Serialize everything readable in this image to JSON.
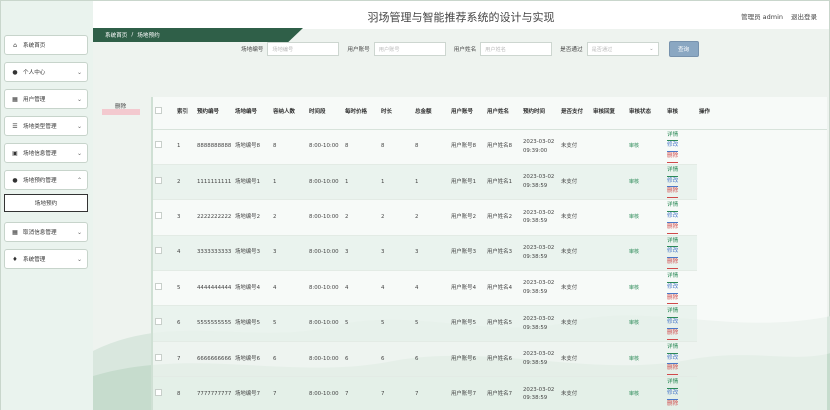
{
  "header": {
    "title": "羽场管理与智能推荐系统的设计与实现",
    "user_label": "管理员 admin",
    "logout": "退出登录"
  },
  "sidebar": {
    "items": [
      {
        "label": "系统首页",
        "icon": "home-icon"
      },
      {
        "label": "个人中心",
        "icon": "person-icon"
      },
      {
        "label": "用户管理",
        "icon": "grid-icon"
      },
      {
        "label": "场地类型管理",
        "icon": "list-icon"
      },
      {
        "label": "场地信息管理",
        "icon": "briefcase-icon"
      },
      {
        "label": "场地预约管理",
        "icon": "person-icon"
      },
      {
        "label": "取消信息管理",
        "icon": "grid-icon"
      },
      {
        "label": "系统管理",
        "icon": "pin-icon"
      }
    ],
    "sub_item": "场地预约"
  },
  "breadcrumb": {
    "home": "系统首页",
    "sep": "/",
    "current": "场地预约"
  },
  "search": {
    "field1_label": "场地编号",
    "field1_placeholder": "场地编号",
    "field2_label": "用户账号",
    "field2_placeholder": "用户账号",
    "field3_label": "用户姓名",
    "field3_placeholder": "用户姓名",
    "field4_label": "是否通过",
    "field4_placeholder": "是否通过",
    "button": "查询"
  },
  "delete_label": "删除",
  "table": {
    "headers": [
      "索引",
      "预约编号",
      "场地编号",
      "容纳人数",
      "时间段",
      "每时价格",
      "时长",
      "总金额",
      "用户账号",
      "用户姓名",
      "预约时间",
      "是否支付",
      "审核回复",
      "审核状态",
      "审核",
      "操作"
    ],
    "rows": [
      [
        "1",
        "8888888888",
        "场地编号8",
        "8",
        "8:00-10:00",
        "8",
        "8",
        "8",
        "用户账号8",
        "用户姓名8",
        "2023-03-02 09:39:00",
        "未支付",
        "",
        "通过",
        "审核"
      ],
      [
        "2",
        "1111111111",
        "场地编号1",
        "1",
        "8:00-10:00",
        "1",
        "1",
        "1",
        "用户账号1",
        "用户姓名1",
        "2023-03-02 09:38:59",
        "未支付",
        "",
        "通过",
        "审核"
      ],
      [
        "3",
        "2222222222",
        "场地编号2",
        "2",
        "8:00-10:00",
        "2",
        "2",
        "2",
        "用户账号2",
        "用户姓名2",
        "2023-03-02 09:38:59",
        "未支付",
        "",
        "通过",
        "审核"
      ],
      [
        "4",
        "3333333333",
        "场地编号3",
        "3",
        "8:00-10:00",
        "3",
        "3",
        "3",
        "用户账号3",
        "用户姓名3",
        "2023-03-02 09:38:59",
        "未支付",
        "",
        "通过",
        "审核"
      ],
      [
        "5",
        "4444444444",
        "场地编号4",
        "4",
        "8:00-10:00",
        "4",
        "4",
        "4",
        "用户账号4",
        "用户姓名4",
        "2023-03-02 09:38:59",
        "未支付",
        "",
        "通过",
        "审核"
      ],
      [
        "6",
        "5555555555",
        "场地编号5",
        "5",
        "8:00-10:00",
        "5",
        "5",
        "5",
        "用户账号5",
        "用户姓名5",
        "2023-03-02 09:38:59",
        "未支付",
        "",
        "通过",
        "审核"
      ],
      [
        "7",
        "6666666666",
        "场地编号6",
        "6",
        "8:00-10:00",
        "6",
        "6",
        "6",
        "用户账号6",
        "用户姓名6",
        "2023-03-02 09:38:59",
        "未支付",
        "",
        "通过",
        "审核"
      ],
      [
        "8",
        "7777777777",
        "场地编号7",
        "7",
        "8:00-10:00",
        "7",
        "7",
        "7",
        "用户账号7",
        "用户姓名7",
        "2023-03-02 09:38:59",
        "未支付",
        "",
        "通过",
        "审核"
      ]
    ],
    "actions": {
      "detail": "详情",
      "edit": "修改",
      "delete": "删除"
    }
  },
  "colors": {
    "brand": "#2f5f48",
    "detail": "#2b8a57",
    "edit": "#4a79c9",
    "delete": "#d04a4a",
    "search_btn": "#8aa7c2"
  }
}
